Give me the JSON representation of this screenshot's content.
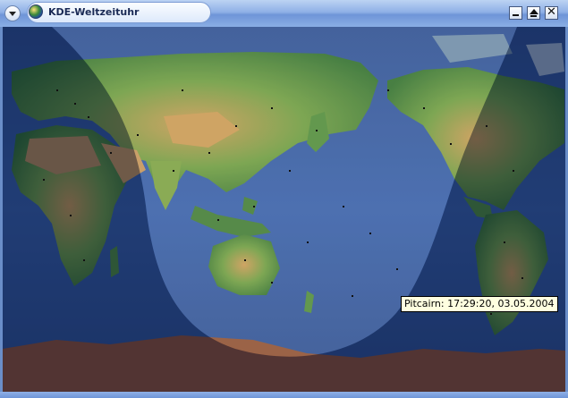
{
  "window": {
    "title": "KDE-Weltzeituhr",
    "menu_icon": "chevron-down-icon",
    "app_icon": "globe-icon",
    "buttons": {
      "minimize_icon": "minimize-icon",
      "maximize_icon": "maximize-icon",
      "close_icon": "close-icon"
    }
  },
  "map": {
    "tooltip": "Pitcairn: 17:29:20, 03.05.2004",
    "colors": {
      "ocean": "#2c4f93",
      "land": "#4e8a36",
      "desert": "#b98a52",
      "ice": "#8e4e2e",
      "night_shade": "#0a1a3a"
    }
  }
}
